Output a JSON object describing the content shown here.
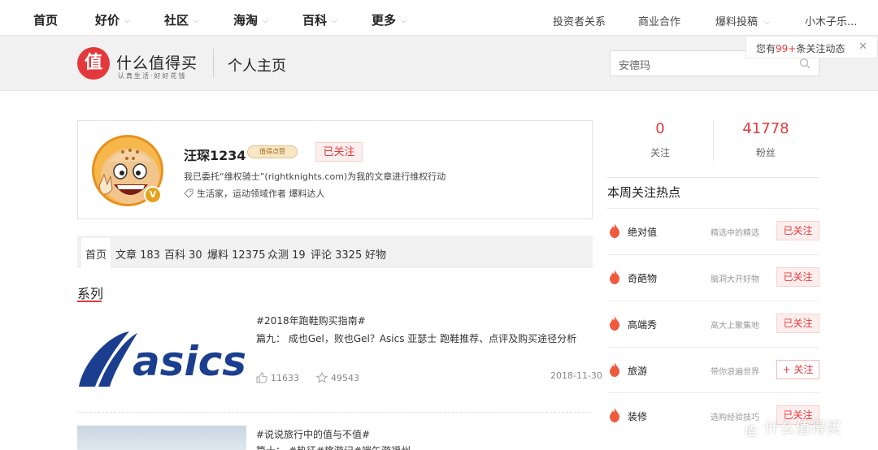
{
  "topnav": {
    "left_items": [
      {
        "label": "首页",
        "has_menu": false
      },
      {
        "label": "好价",
        "has_menu": true
      },
      {
        "label": "社区",
        "has_menu": true
      },
      {
        "label": "海淘",
        "has_menu": true
      },
      {
        "label": "百科",
        "has_menu": true
      },
      {
        "label": "更多",
        "has_menu": true
      }
    ],
    "right_items": [
      "投资者关系",
      "商业合作",
      "爆料投稿",
      "小木子乐..."
    ],
    "notice": {
      "prefix": "您有",
      "count": "99+",
      "suffix": "条关注动态"
    }
  },
  "header": {
    "logo_char": "值",
    "logo_title": "什么值得买",
    "logo_sub": "认真生活·好好花钱",
    "page_title": "个人主页",
    "search_value": "安德玛"
  },
  "profile": {
    "username": "汪琛1234",
    "badge": "值得点赞",
    "follow_status": "已关注",
    "description": "我已委托“维权骑士”(rightknights.com)为我的文章进行维权行动",
    "tags": "生活家，运动领域作者 爆料达人",
    "avatar_badge": "V"
  },
  "stats": {
    "following": {
      "value": "0",
      "label": "关注"
    },
    "fans": {
      "value": "41778",
      "label": "粉丝"
    }
  },
  "tabs": [
    "首页",
    "文章 183",
    "百科 30",
    "爆料 12375",
    "众测 19",
    "评论 3325",
    "好物"
  ],
  "series": {
    "title": "系列",
    "posts": [
      {
        "tag": "#2018年跑鞋购买指南#",
        "title": "篇九： 成也Gel，败也Gel？Asics 亚瑟士 跑鞋推荐、点评及购买途径分析",
        "thumb_text": "asics",
        "likes": "11633",
        "favorites": "49543",
        "date": "2018-11-30"
      },
      {
        "tag": "#说说旅行中的值与不值#",
        "title_partial": "篇十： #热征#旅游记#端午游福州"
      }
    ]
  },
  "hot": {
    "title": "本周关注热点",
    "items": [
      {
        "name": "绝对值",
        "desc": "精选中的精选",
        "status": "已关注",
        "followed": true
      },
      {
        "name": "奇葩物",
        "desc": "脑洞大开好物",
        "status": "已关注",
        "followed": true
      },
      {
        "name": "高端秀",
        "desc": "高大上聚集地",
        "status": "已关注",
        "followed": true
      },
      {
        "name": "旅游",
        "desc": "带你浪遍世界",
        "status": "+ 关注",
        "followed": false
      },
      {
        "name": "装修",
        "desc": "选购经验技巧",
        "status": "已关注",
        "followed": true
      }
    ]
  },
  "watermark": {
    "char": "值",
    "text": "什么值得买"
  },
  "colors": {
    "brand_red": "#e4393c",
    "asics_blue": "#1b3f8e",
    "flame": "#f05a3c"
  }
}
